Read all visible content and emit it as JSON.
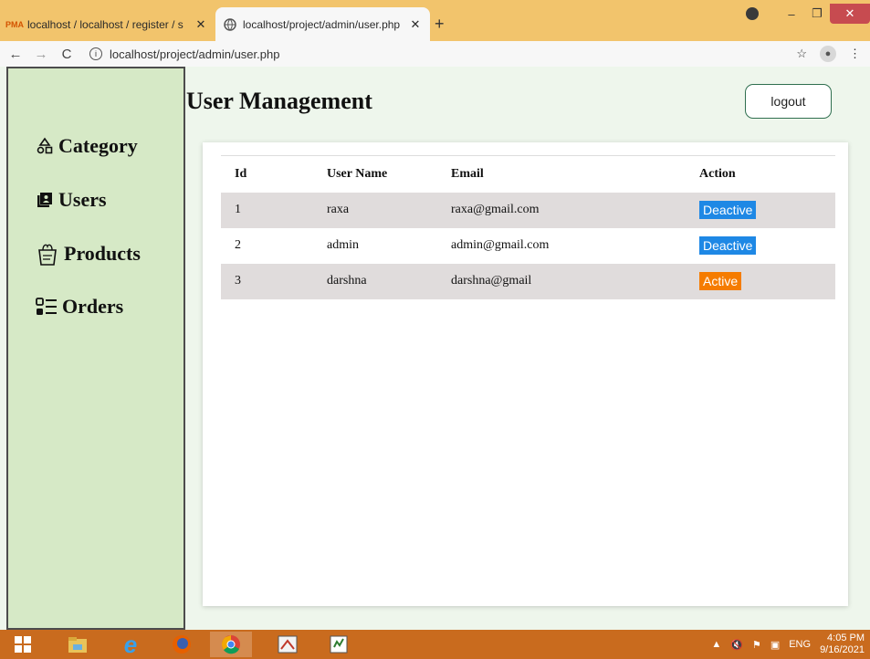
{
  "browser": {
    "tabs": [
      {
        "title": "localhost / localhost / register / s",
        "active": false
      },
      {
        "title": "localhost/project/admin/user.php",
        "active": true
      }
    ],
    "url": "localhost/project/admin/user.php",
    "icons": [
      "back-icon",
      "forward-icon",
      "reload-icon",
      "info-icon",
      "star-icon",
      "profile-icon",
      "menu-icon"
    ]
  },
  "sidebar": {
    "items": [
      {
        "label": "Category",
        "icon": "category-shapes-icon"
      },
      {
        "label": "Users",
        "icon": "users-book-icon"
      },
      {
        "label": "Products",
        "icon": "products-basket-icon"
      },
      {
        "label": "Orders",
        "icon": "orders-list-icon"
      }
    ]
  },
  "header": {
    "title": "User Management",
    "logout_label": "logout"
  },
  "table": {
    "columns": [
      "Id",
      "User Name",
      "Email",
      "Action"
    ],
    "rows": [
      {
        "id": "1",
        "name": "raxa",
        "email": "raxa@gmail.com",
        "action": "Deactive",
        "action_color": "#1e88e5"
      },
      {
        "id": "2",
        "name": "admin",
        "email": "admin@gmail.com",
        "action": "Deactive",
        "action_color": "#1e88e5"
      },
      {
        "id": "3",
        "name": "darshna",
        "email": "darshna@gmail",
        "action": "Active",
        "action_color": "#f57c00"
      }
    ]
  },
  "taskbar": {
    "lang": "ENG",
    "time": "4:05 PM",
    "date": "9/16/2021"
  },
  "colors": {
    "sidebar_bg": "#d6e9c6",
    "page_bg": "#eef6ec",
    "row_shade": "#e0dcdc",
    "taskbar": "#c96b1e"
  }
}
